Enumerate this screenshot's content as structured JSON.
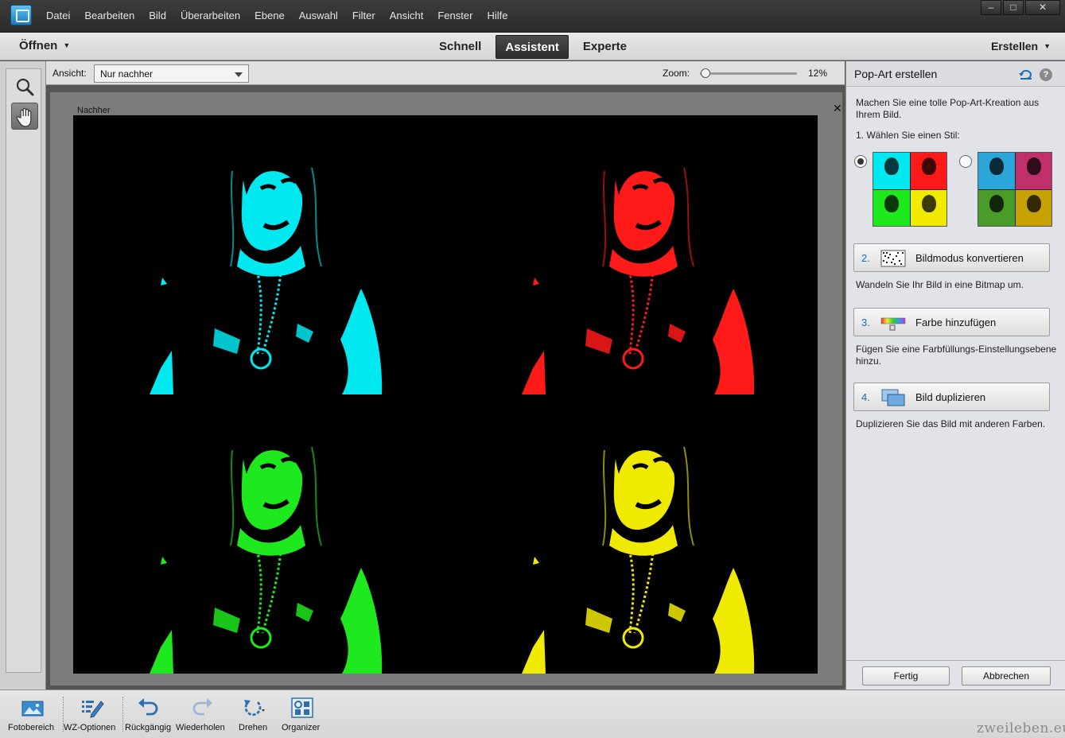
{
  "menu": [
    "Datei",
    "Bearbeiten",
    "Bild",
    "Überarbeiten",
    "Ebene",
    "Auswahl",
    "Filter",
    "Ansicht",
    "Fenster",
    "Hilfe"
  ],
  "window_controls": {
    "minimize": "–",
    "maximize": "□",
    "close": "✕"
  },
  "modebar": {
    "open_label": "Öffnen",
    "modes": [
      "Schnell",
      "Assistent",
      "Experte"
    ],
    "active_mode": "Assistent",
    "create_label": "Erstellen"
  },
  "tools": [
    {
      "name": "zoom-tool",
      "icon": "magnifier-icon",
      "selected": false
    },
    {
      "name": "hand-tool",
      "icon": "hand-icon",
      "selected": true
    }
  ],
  "options": {
    "view_label": "Ansicht:",
    "view_value": "Nur nachher",
    "zoom_label": "Zoom:",
    "zoom_value": "12%",
    "zoom_level": 0.02
  },
  "document": {
    "label": "Nachher",
    "close": "✕",
    "quadrant_colors": [
      "#00e8f0",
      "#ff1a1a",
      "#1ee81e",
      "#f0ea00"
    ]
  },
  "panel": {
    "title": "Pop-Art erstellen",
    "help": "?",
    "intro": "Machen Sie eine tolle Pop-Art-Kreation aus Ihrem Bild.",
    "step1": "1. Wählen Sie einen Stil:",
    "style_options": [
      {
        "selected": true,
        "colors": [
          "#00e8f0",
          "#ff1a1a",
          "#1ee81e",
          "#f0ea00"
        ]
      },
      {
        "selected": false,
        "colors": [
          "#2aa6d8",
          "#c0306a",
          "#4a9c2a",
          "#c8a200"
        ]
      }
    ],
    "steps": [
      {
        "num": "2.",
        "label": "Bildmodus konvertieren",
        "icon": "bitmap-icon",
        "desc": "Wandeln Sie Ihr Bild in eine Bitmap um."
      },
      {
        "num": "3.",
        "label": "Farbe hinzufügen",
        "icon": "color-gradient-icon",
        "desc": "Fügen Sie eine Farbfüllungs-Einstellungsebene hinzu."
      },
      {
        "num": "4.",
        "label": "Bild duplizieren",
        "icon": "duplicate-icon",
        "desc": "Duplizieren Sie das Bild mit anderen Farben."
      }
    ],
    "done_label": "Fertig",
    "cancel_label": "Abbrechen"
  },
  "bottombar": [
    {
      "label": "Fotobereich",
      "icon": "photo-bin-icon"
    },
    {
      "label": "WZ-Optionen",
      "icon": "tool-options-icon"
    },
    {
      "label": "Rückgängig",
      "icon": "undo-icon"
    },
    {
      "label": "Wiederholen",
      "icon": "redo-icon"
    },
    {
      "label": "Drehen",
      "icon": "rotate-icon"
    },
    {
      "label": "Organizer",
      "icon": "organizer-icon"
    }
  ],
  "watermark": "zweileben.eu"
}
